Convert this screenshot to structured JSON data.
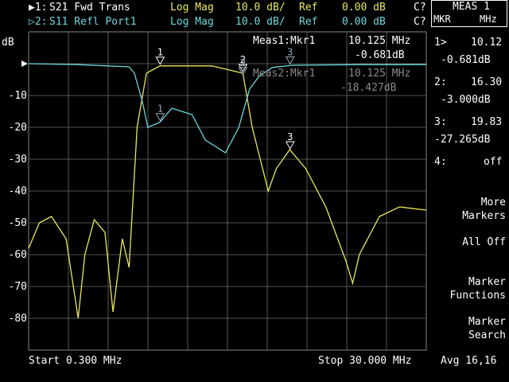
{
  "trace_header": {
    "trace1": {
      "marker": "▶1:",
      "name": "S21 Fwd Trans",
      "format": "Log Mag",
      "scale": "10.0 dB/",
      "ref_label": "Ref",
      "ref_value": "0.00 dB",
      "cal": "C?"
    },
    "trace2": {
      "marker": "▷2:",
      "name": "S11 Refl Port1",
      "format": "Log Mag",
      "scale": "10.0 dB/",
      "ref_label": "Ref",
      "ref_value": "0.00 dB",
      "cal": "C?"
    }
  },
  "y_unit": "dB",
  "colors": {
    "trace1": "#e8e85a",
    "trace2": "#6ad8dc",
    "grid": "#6e6e6e",
    "background": "#000000"
  },
  "readout1": {
    "label": "Meas1:Mkr1",
    "freq": "10.125 MHz",
    "value": "-0.681dB"
  },
  "readout2": {
    "label": "Meas2:Mkr1",
    "freq": "10.125 MHz",
    "value": "-18.427dB"
  },
  "marker_labels": {
    "m1": "1",
    "m2": "2",
    "m3": "3"
  },
  "footer": {
    "start": "Start 0.300 MHz",
    "stop": "Stop 30.000 MHz"
  },
  "softkeys": {
    "meas_title": "MEAS 1",
    "col_left": "MKR",
    "col_right": "MHz",
    "markers": [
      {
        "id": "1>",
        "freq": "10.12",
        "value": "-0.681dB"
      },
      {
        "id": "2:",
        "freq": "16.30",
        "value": "-3.000dB"
      },
      {
        "id": "3:",
        "freq": "19.83",
        "value": "-27.265dB"
      },
      {
        "id": "4:",
        "freq": "off",
        "value": ""
      }
    ],
    "more_markers": "More\nMarkers",
    "all_off": "All Off",
    "marker_functions": "Marker\nFunctions",
    "marker_search": "Marker\nSearch",
    "avg": "Avg 16,16"
  },
  "chart_data": {
    "type": "line",
    "x_start_mhz": 0.3,
    "x_stop_mhz": 30.0,
    "ylim": [
      -90,
      0
    ],
    "y_ticks": [
      "-10",
      "-20",
      "-30",
      "-40",
      "-50",
      "-60",
      "-70",
      "-80"
    ],
    "grid": true,
    "series": [
      {
        "name": "S21 Fwd Trans",
        "x": [
          0.3,
          1.1,
          2.0,
          3.1,
          4.0,
          4.5,
          5.2,
          6.0,
          6.6,
          7.3,
          7.8,
          8.4,
          9.1,
          10.1,
          12.0,
          14.0,
          16.3,
          17.0,
          18.2,
          18.8,
          19.8,
          21.0,
          22.5,
          24.0,
          24.5,
          25.0,
          26.5,
          28.0,
          30.0
        ],
        "y": [
          -58,
          -50,
          -48,
          -55,
          -80,
          -60,
          -49,
          -53,
          -78,
          -55,
          -64,
          -20,
          -3,
          -0.7,
          -0.7,
          -0.7,
          -3,
          -20,
          -40,
          -33,
          -27,
          -33,
          -45,
          -62,
          -69,
          -60,
          -48,
          -45,
          -46
        ]
      },
      {
        "name": "S11 Refl Port1",
        "x": [
          0.3,
          4.0,
          7.8,
          8.2,
          8.8,
          9.2,
          10.1,
          11.0,
          12.5,
          13.5,
          15.0,
          16.0,
          16.8,
          17.5,
          18.5,
          20.0,
          25.0,
          30.0
        ],
        "y": [
          0,
          -0.3,
          -1,
          -3,
          -12,
          -20,
          -18.4,
          -14,
          -16,
          -24,
          -28,
          -20,
          -8,
          -4,
          -1.2,
          -0.5,
          -0.3,
          -0.3
        ]
      }
    ]
  }
}
